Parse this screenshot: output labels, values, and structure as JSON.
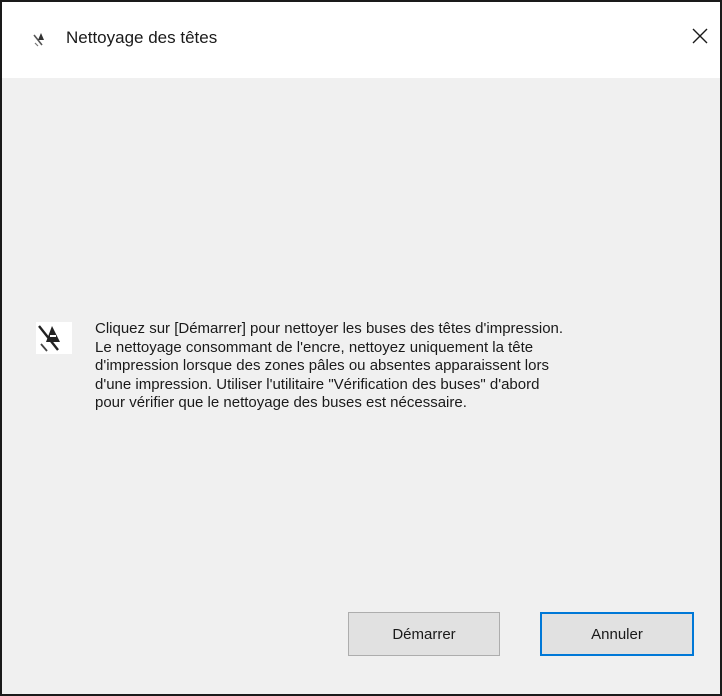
{
  "window": {
    "title": "Nettoyage des têtes",
    "title_icon": "printhead-cleaning-icon",
    "close_icon": "close-icon"
  },
  "content": {
    "icon": "printhead-cleaning-icon",
    "message_lines": [
      "Cliquez sur [Démarrer] pour nettoyer les buses des têtes d'impression.",
      "Le nettoyage consommant de l'encre, nettoyez uniquement la tête",
      "d'impression lorsque des zones pâles ou absentes apparaissent lors",
      "d'une impression. Utiliser l'utilitaire \"Vérification des buses\" d'abord",
      "pour vérifier que le nettoyage des buses est nécessaire."
    ]
  },
  "buttons": {
    "start_label": "Démarrer",
    "cancel_label": "Annuler"
  },
  "colors": {
    "focus_border": "#0078d7",
    "dialog_background": "#f0f0f0",
    "titlebar_background": "#ffffff"
  }
}
